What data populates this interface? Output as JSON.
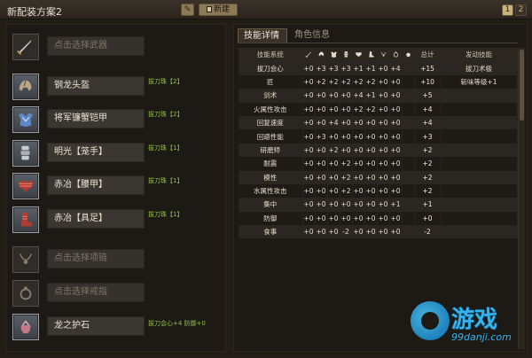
{
  "window": {
    "title": "新配装方案2",
    "new_label": "新建",
    "pages": [
      "1",
      "2"
    ]
  },
  "equipment": [
    {
      "slot": "weapon",
      "icon": "sword-icon",
      "name": "点击选择武器",
      "empty": true,
      "jewel": ""
    },
    {
      "slot": "head",
      "icon": "helmet-icon",
      "name": "钢龙头盔",
      "empty": false,
      "jewel": "拔刀珠【2】"
    },
    {
      "slot": "chest",
      "icon": "chest-armor-icon",
      "name": "将军镰蟹铠甲",
      "empty": false,
      "jewel": "拔刀珠【2】"
    },
    {
      "slot": "arms",
      "icon": "gauntlet-icon",
      "name": "明光【笼手】",
      "empty": false,
      "jewel": "拔刀珠【1】"
    },
    {
      "slot": "waist",
      "icon": "waist-armor-icon",
      "name": "赤冶【腰甲】",
      "empty": false,
      "jewel": "拔刀珠【1】"
    },
    {
      "slot": "legs",
      "icon": "boots-icon",
      "name": "赤冶【具足】",
      "empty": false,
      "jewel": "拔刀珠【1】"
    },
    {
      "slot": "necklace",
      "icon": "necklace-icon",
      "name": "点击选择项链",
      "empty": true,
      "jewel": ""
    },
    {
      "slot": "ring",
      "icon": "ring-icon",
      "name": "点击选择戒指",
      "empty": true,
      "jewel": ""
    },
    {
      "slot": "charm",
      "icon": "charm-pouch-icon",
      "name": "龙之护石",
      "empty": false,
      "jewel": "拔刀会心+4 防御+0"
    }
  ],
  "tabs": [
    "技能详情",
    "角色信息"
  ],
  "skill_table": {
    "headers": {
      "system": "技能系统",
      "total": "总计",
      "activated": "发动技能"
    },
    "column_icons": [
      "sword-icon",
      "helmet-icon",
      "chest-armor-icon",
      "gauntlet-icon",
      "waist-armor-icon",
      "boots-icon",
      "necklace-icon",
      "ring-icon",
      "charm-icon"
    ],
    "rows": [
      {
        "name": "拔刀会心",
        "vals": [
          "+0",
          "+3",
          "+3",
          "+3",
          "+1",
          "+1",
          "+0",
          "+4"
        ],
        "total": "+15",
        "skill": "拔刀术极"
      },
      {
        "name": "匠",
        "vals": [
          "+0",
          "+2",
          "+2",
          "+2",
          "+2",
          "+2",
          "+0",
          "+0"
        ],
        "total": "+10",
        "skill": "斩味等级+1"
      },
      {
        "name": "剑术",
        "vals": [
          "+0",
          "+0",
          "+0",
          "+0",
          "+4",
          "+1",
          "+0",
          "+0"
        ],
        "total": "+5",
        "skill": ""
      },
      {
        "name": "火属性攻击",
        "vals": [
          "+0",
          "+0",
          "+0",
          "+0",
          "+2",
          "+2",
          "+0",
          "+0"
        ],
        "total": "+4",
        "skill": ""
      },
      {
        "name": "回复速度",
        "vals": [
          "+0",
          "+0",
          "+4",
          "+0",
          "+0",
          "+0",
          "+0",
          "+0"
        ],
        "total": "+4",
        "skill": ""
      },
      {
        "name": "回避性能",
        "vals": [
          "+0",
          "+3",
          "+0",
          "+0",
          "+0",
          "+0",
          "+0",
          "+0"
        ],
        "total": "+3",
        "skill": ""
      },
      {
        "name": "研磨师",
        "vals": [
          "+0",
          "+0",
          "+2",
          "+0",
          "+0",
          "+0",
          "+0",
          "+0"
        ],
        "total": "+2",
        "skill": ""
      },
      {
        "name": "耐震",
        "vals": [
          "+0",
          "+0",
          "+0",
          "+2",
          "+0",
          "+0",
          "+0",
          "+0"
        ],
        "total": "+2",
        "skill": ""
      },
      {
        "name": "模性",
        "vals": [
          "+0",
          "+0",
          "+0",
          "+2",
          "+0",
          "+0",
          "+0",
          "+0"
        ],
        "total": "+2",
        "skill": ""
      },
      {
        "name": "水属性攻击",
        "vals": [
          "+0",
          "+0",
          "+0",
          "+2",
          "+0",
          "+0",
          "+0",
          "+0"
        ],
        "total": "+2",
        "skill": ""
      },
      {
        "name": "集中",
        "vals": [
          "+0",
          "+0",
          "+0",
          "+0",
          "+0",
          "+0",
          "+0",
          "+1"
        ],
        "total": "+1",
        "skill": ""
      },
      {
        "name": "防御",
        "vals": [
          "+0",
          "+0",
          "+0",
          "+0",
          "+0",
          "+0",
          "+0",
          "+0"
        ],
        "total": "+0",
        "skill": ""
      },
      {
        "name": "食事",
        "vals": [
          "+0",
          "+0",
          "+0",
          "-2",
          "+0",
          "+0",
          "+0",
          "+0"
        ],
        "total": "-2",
        "skill": ""
      }
    ]
  },
  "watermark": {
    "text": "游戏",
    "url": "99danji.com"
  }
}
